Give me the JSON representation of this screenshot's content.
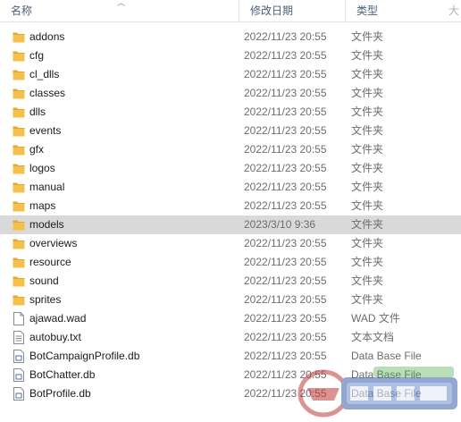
{
  "header": {
    "name": "名称",
    "date": "修改日期",
    "type": "类型"
  },
  "files": [
    {
      "name": "addons",
      "date": "2022/11/23 20:55",
      "type": "文件夹",
      "icon": "folder-icon"
    },
    {
      "name": "cfg",
      "date": "2022/11/23 20:55",
      "type": "文件夹",
      "icon": "folder-icon"
    },
    {
      "name": "cl_dlls",
      "date": "2022/11/23 20:55",
      "type": "文件夹",
      "icon": "folder-icon"
    },
    {
      "name": "classes",
      "date": "2022/11/23 20:55",
      "type": "文件夹",
      "icon": "folder-icon"
    },
    {
      "name": "dlls",
      "date": "2022/11/23 20:55",
      "type": "文件夹",
      "icon": "folder-icon"
    },
    {
      "name": "events",
      "date": "2022/11/23 20:55",
      "type": "文件夹",
      "icon": "folder-icon"
    },
    {
      "name": "gfx",
      "date": "2022/11/23 20:55",
      "type": "文件夹",
      "icon": "folder-icon"
    },
    {
      "name": "logos",
      "date": "2022/11/23 20:55",
      "type": "文件夹",
      "icon": "folder-icon"
    },
    {
      "name": "manual",
      "date": "2022/11/23 20:55",
      "type": "文件夹",
      "icon": "folder-icon"
    },
    {
      "name": "maps",
      "date": "2022/11/23 20:55",
      "type": "文件夹",
      "icon": "folder-icon"
    },
    {
      "name": "models",
      "date": "2023/3/10 9:36",
      "type": "文件夹",
      "icon": "folder-icon",
      "selected": true
    },
    {
      "name": "overviews",
      "date": "2022/11/23 20:55",
      "type": "文件夹",
      "icon": "folder-icon"
    },
    {
      "name": "resource",
      "date": "2022/11/23 20:55",
      "type": "文件夹",
      "icon": "folder-icon"
    },
    {
      "name": "sound",
      "date": "2022/11/23 20:55",
      "type": "文件夹",
      "icon": "folder-icon"
    },
    {
      "name": "sprites",
      "date": "2022/11/23 20:55",
      "type": "文件夹",
      "icon": "folder-icon"
    },
    {
      "name": "ajawad.wad",
      "date": "2022/11/23 20:55",
      "type": "WAD 文件",
      "icon": "file-icon"
    },
    {
      "name": "autobuy.txt",
      "date": "2022/11/23 20:55",
      "type": "文本文档",
      "icon": "text-file-icon"
    },
    {
      "name": "BotCampaignProfile.db",
      "date": "2022/11/23 20:55",
      "type": "Data Base File",
      "icon": "db-file-icon"
    },
    {
      "name": "BotChatter.db",
      "date": "2022/11/23 20:55",
      "type": "Data Base File",
      "icon": "db-file-icon"
    },
    {
      "name": "BotProfile.db",
      "date": "2022/11/23 20:55",
      "type": "Data Base File",
      "icon": "db-file-icon"
    }
  ],
  "colors": {
    "folder": "#f4c14d",
    "folder_tab": "#e3a92a",
    "selected_row": "#d9d9d9"
  }
}
